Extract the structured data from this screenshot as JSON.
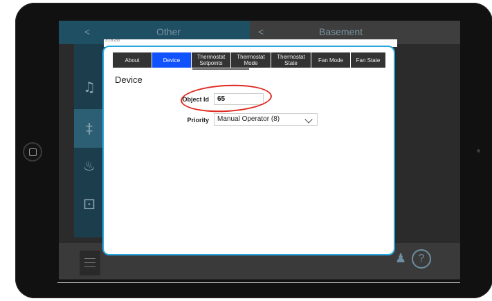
{
  "header": {
    "left_title": "Other",
    "right_title": "Basement",
    "back_glyph": "<"
  },
  "dialog": {
    "top_caption": "3.1.8.233",
    "tabs": [
      {
        "label": "About"
      },
      {
        "label": "Device"
      },
      {
        "label": "Thermostat Setpoints"
      },
      {
        "label": "Thermostat Mode"
      },
      {
        "label": "Thermostat State"
      },
      {
        "label": "Fan Mode"
      },
      {
        "label": "Fan State"
      }
    ],
    "active_tab": "Device",
    "section_title": "Device",
    "object_id": {
      "label": "Object Id",
      "value": "65"
    },
    "priority": {
      "label": "Priority",
      "value": "Manual Operator (8)"
    }
  },
  "nav_icons": [
    "music-icon",
    "thermometer-icon",
    "fire-icon",
    "fountain-icon"
  ],
  "colors": {
    "active_tab": "#1152ff",
    "dialog_border": "#27a7e0",
    "annotation": "#e0281f"
  }
}
